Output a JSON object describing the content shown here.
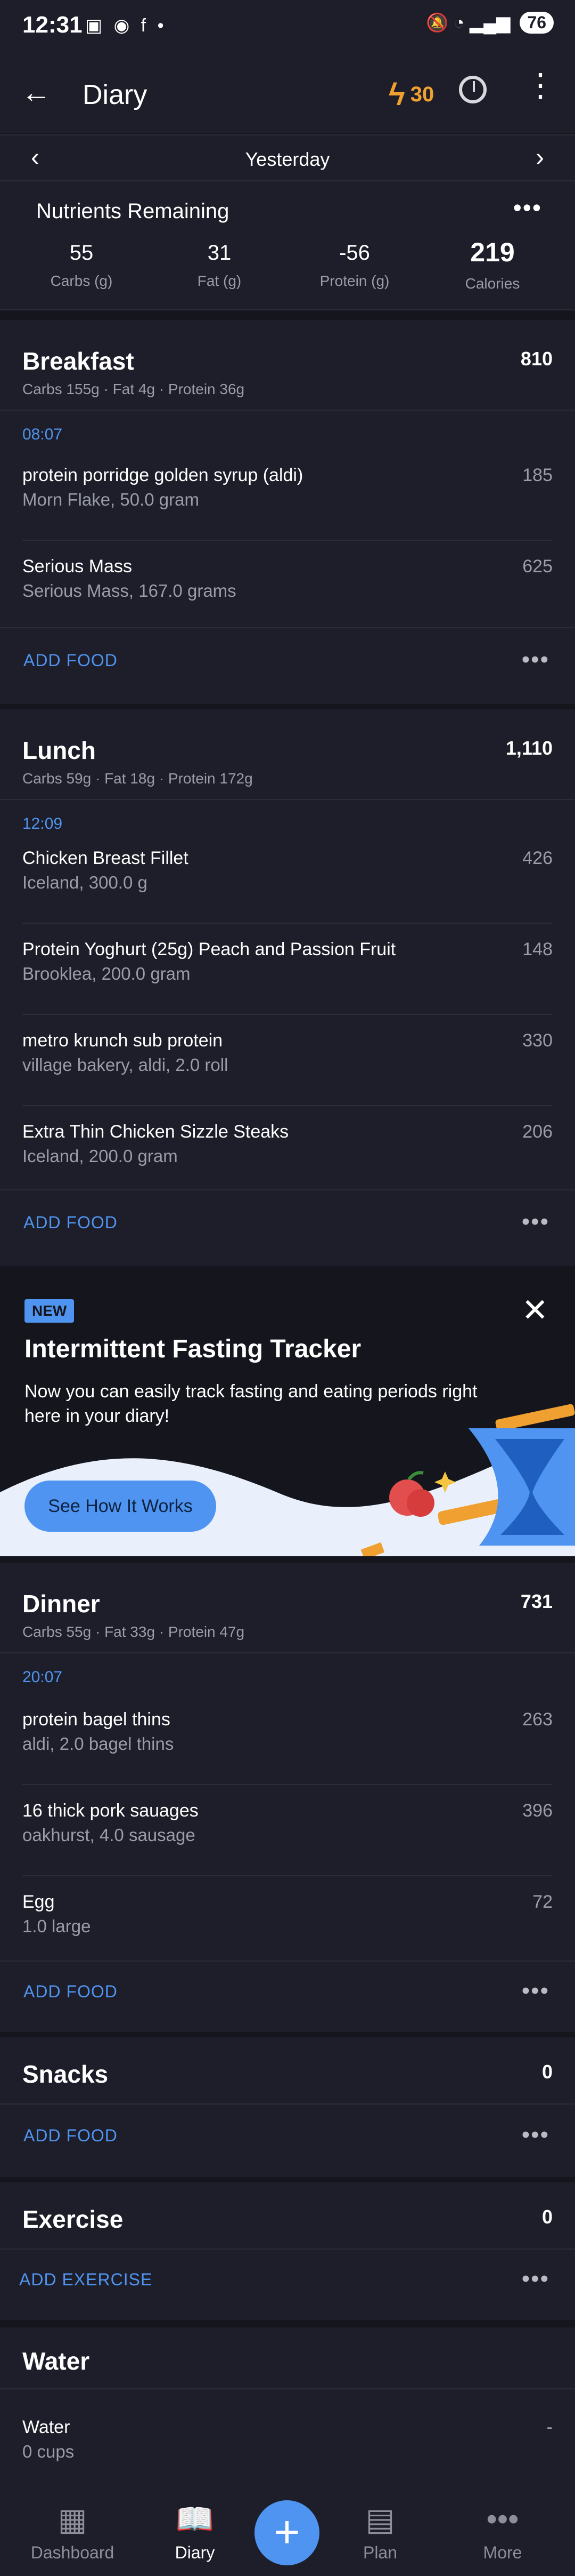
{
  "status_bar": {
    "time": "12:31",
    "battery": "76",
    "notification_icons": "▣ ◉ f •",
    "system_icons": "🔕 ◔ ▂▄▆"
  },
  "app_bar": {
    "title": "Diary",
    "streak": "30"
  },
  "date_bar": {
    "label": "Yesterday"
  },
  "nutrients": {
    "title": "Nutrients Remaining",
    "items": [
      {
        "value": "55",
        "label": "Carbs (g)"
      },
      {
        "value": "31",
        "label": "Fat (g)"
      },
      {
        "value": "-56",
        "label": "Protein (g)"
      },
      {
        "value": "219",
        "label": "Calories"
      }
    ]
  },
  "meals": {
    "breakfast": {
      "title": "Breakfast",
      "calories": "810",
      "macros": "Carbs 155g · Fat 4g · Protein 36g",
      "time": "08:07",
      "items": [
        {
          "name": "protein porridge golden syrup (aldi)",
          "detail": "Morn Flake, 50.0 gram",
          "kcal": "185"
        },
        {
          "name": "Serious Mass",
          "detail": "Serious Mass, 167.0 grams",
          "kcal": "625"
        }
      ]
    },
    "lunch": {
      "title": "Lunch",
      "calories": "1,110",
      "macros": "Carbs 59g · Fat 18g · Protein 172g",
      "time": "12:09",
      "items": [
        {
          "name": "Chicken  Breast Fillet",
          "detail": "Iceland, 300.0 g",
          "kcal": "426"
        },
        {
          "name": "Protein Yoghurt (25g) Peach and Passion Fruit",
          "detail": "Brooklea, 200.0 gram",
          "kcal": "148"
        },
        {
          "name": "metro krunch sub protein",
          "detail": "village bakery, aldi, 2.0 roll",
          "kcal": "330"
        },
        {
          "name": "Extra Thin Chicken Sizzle Steaks",
          "detail": "Iceland, 200.0 gram",
          "kcal": "206"
        }
      ]
    },
    "dinner": {
      "title": "Dinner",
      "calories": "731",
      "macros": "Carbs 55g · Fat 33g · Protein 47g",
      "time": "20:07",
      "items": [
        {
          "name": "protein bagel thins",
          "detail": "aldi, 2.0 bagel thins",
          "kcal": "263"
        },
        {
          "name": "16 thick pork sauages",
          "detail": "oakhurst, 4.0 sausage",
          "kcal": "396"
        },
        {
          "name": "Egg",
          "detail": "1.0 large",
          "kcal": "72"
        }
      ]
    },
    "snacks": {
      "title": "Snacks",
      "calories": "0"
    }
  },
  "actions": {
    "add_food": "ADD FOOD",
    "add_exercise": "ADD EXERCISE",
    "more": "•••"
  },
  "promo": {
    "badge": "NEW",
    "title": "Intermittent Fasting Tracker",
    "description": "Now you can easily track fasting and eating periods right here in your diary!",
    "cta": "See How It Works"
  },
  "exercise": {
    "title": "Exercise",
    "calories": "0"
  },
  "water": {
    "title": "Water",
    "item_name": "Water",
    "item_detail": "0 cups",
    "item_value": "-"
  },
  "bottom_nav": {
    "items": [
      {
        "label": "Dashboard"
      },
      {
        "label": "Diary"
      },
      {
        "label": "Plan"
      },
      {
        "label": "More"
      }
    ]
  },
  "colors": {
    "background": "#14151d",
    "card": "#1d1e29",
    "accent": "#4f94f0",
    "streak": "#f0a030"
  }
}
